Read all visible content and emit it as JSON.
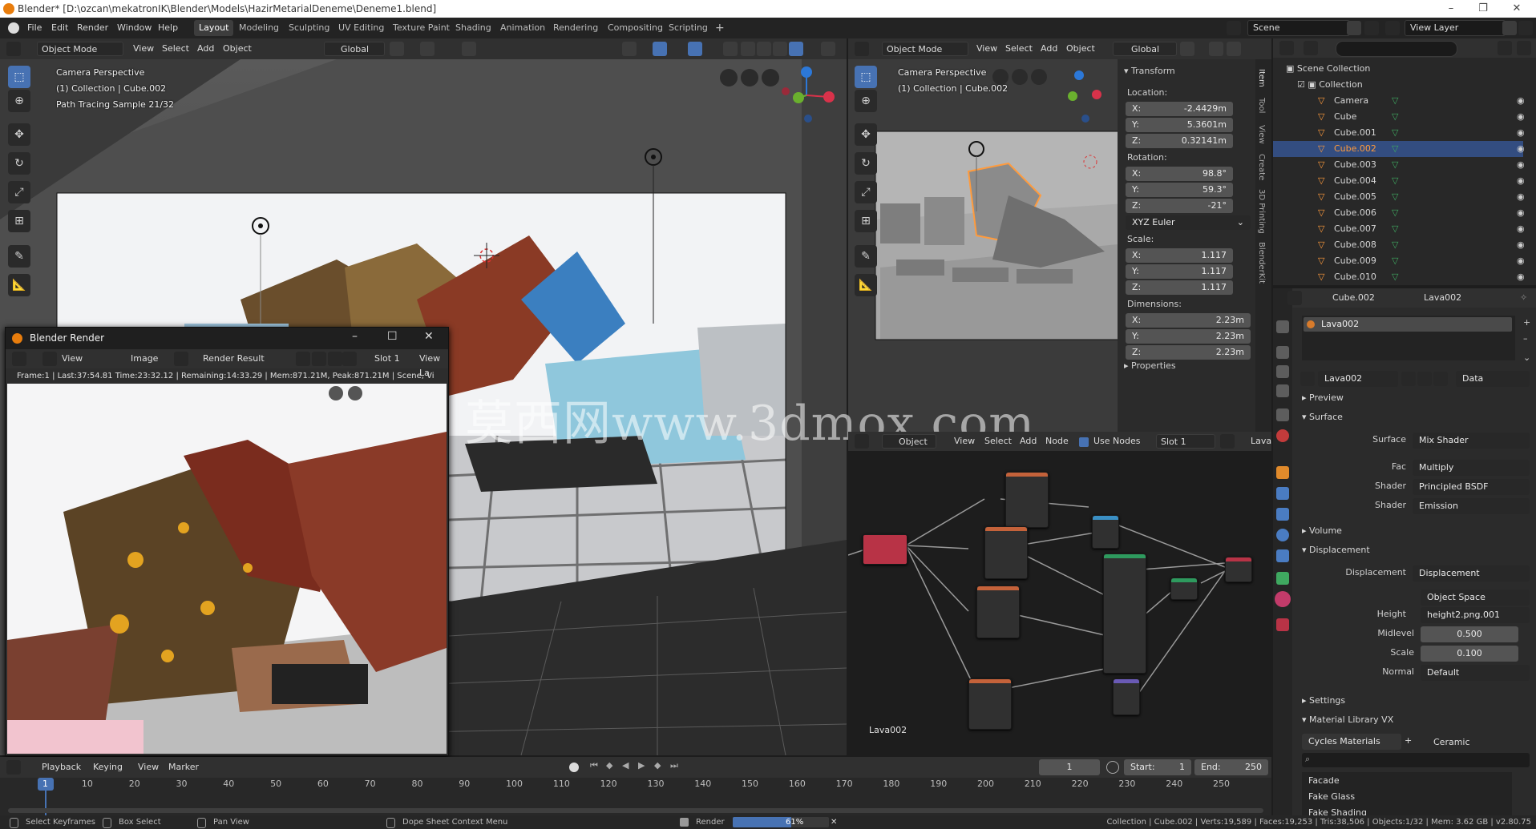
{
  "window": {
    "title": "Blender* [D:\\ozcan\\mekatronIK\\Blender\\Models\\HazirMetarialDeneme\\Deneme1.blend]",
    "controls": [
      "–",
      "❐",
      "✕"
    ]
  },
  "menu": {
    "items": [
      "File",
      "Edit",
      "Render",
      "Window",
      "Help"
    ],
    "workspaces": [
      "Layout",
      "Modeling",
      "Sculpting",
      "UV Editing",
      "Texture Paint",
      "Shading",
      "Animation",
      "Rendering",
      "Compositing",
      "Scripting"
    ],
    "active_workspace": "Layout",
    "add_workspace": "+",
    "scene": "Scene",
    "view_layer": "View Layer"
  },
  "viewport1": {
    "mode": "Object Mode",
    "menus": [
      "View",
      "Select",
      "Add",
      "Object"
    ],
    "orientation": "Global",
    "overlay": [
      "Camera Perspective",
      "(1) Collection | Cube.002",
      "Path Tracing Sample 21/32"
    ]
  },
  "viewport2": {
    "mode": "Object Mode",
    "menus": [
      "View",
      "Select",
      "Add",
      "Object"
    ],
    "orientation": "Global",
    "overlay": [
      "Camera Perspective",
      "(1) Collection | Cube.002"
    ]
  },
  "npanel": {
    "title": "Transform",
    "location_label": "Location:",
    "location": [
      {
        "axis": "X:",
        "value": "-2.4429m"
      },
      {
        "axis": "Y:",
        "value": "5.3601m"
      },
      {
        "axis": "Z:",
        "value": "0.32141m"
      }
    ],
    "rotation_label": "Rotation:",
    "rotation": [
      {
        "axis": "X:",
        "value": "98.8°"
      },
      {
        "axis": "Y:",
        "value": "59.3°"
      },
      {
        "axis": "Z:",
        "value": "-21°"
      }
    ],
    "rotation_mode": "XYZ Euler",
    "scale_label": "Scale:",
    "scale": [
      {
        "axis": "X:",
        "value": "1.117"
      },
      {
        "axis": "Y:",
        "value": "1.117"
      },
      {
        "axis": "Z:",
        "value": "1.117"
      }
    ],
    "dimensions_label": "Dimensions:",
    "dimensions": [
      {
        "axis": "X:",
        "value": "2.23m"
      },
      {
        "axis": "Y:",
        "value": "2.23m"
      },
      {
        "axis": "Z:",
        "value": "2.23m"
      }
    ],
    "properties": "Properties",
    "tabs": [
      "Item",
      "Tool",
      "View",
      "Create",
      "3D Printing",
      "BlenderKit"
    ]
  },
  "render_window": {
    "title": "Blender Render",
    "menus": [
      "View",
      "Image"
    ],
    "result": "Render Result",
    "slot": "Slot 1",
    "view_layer": "View La",
    "info": "Frame:1 | Last:37:54.81 Time:23:32.12 | Remaining:14:33.29 | Mem:871.21M, Peak:871.21M | Scene, Vi"
  },
  "watermark": "莫西网www.3dmox.com",
  "node_editor": {
    "type": "Object",
    "menus": [
      "View",
      "Select",
      "Add",
      "Node"
    ],
    "use_nodes": "Use Nodes",
    "slot": "Slot 1",
    "material": "Lava",
    "label": "Lava002"
  },
  "outliner": {
    "scene_collection": "Scene Collection",
    "collection": "Collection",
    "items": [
      "Camera",
      "Cube",
      "Cube.001",
      "Cube.002",
      "Cube.003",
      "Cube.004",
      "Cube.005",
      "Cube.006",
      "Cube.007",
      "Cube.008",
      "Cube.009",
      "Cube.010"
    ],
    "selected": "Cube.002"
  },
  "properties": {
    "object": "Cube.002",
    "material": "Lava002",
    "slot_item": "Lava002",
    "datablock": "Lava002",
    "link": "Data",
    "sections": {
      "preview": "Preview",
      "surface": "Surface",
      "volume": "Volume",
      "displacement": "Displacement",
      "settings": "Settings",
      "matlib": "Material Library VX"
    },
    "surface_rows": [
      {
        "label": "Surface",
        "value": "Mix Shader"
      },
      {
        "label": "Fac",
        "value": "Multiply"
      },
      {
        "label": "Shader",
        "value": "Principled BSDF"
      },
      {
        "label": "Shader",
        "value": "Emission"
      }
    ],
    "displacement_rows": [
      {
        "label": "Displacement",
        "value": "Displacement"
      },
      {
        "label": "",
        "value": "Object Space"
      },
      {
        "label": "Height",
        "value": "height2.png.001"
      }
    ],
    "midlevel": {
      "label": "Midlevel",
      "value": "0.500"
    },
    "scale": {
      "label": "Scale",
      "value": "0.100"
    },
    "normal": {
      "label": "Normal",
      "value": "Default"
    },
    "library": "Cycles Materials",
    "library_category": "Ceramic",
    "library_items": [
      "Facade",
      "Fake Glass",
      "Fake Shading"
    ]
  },
  "timeline": {
    "menus": [
      "Playback",
      "Keying",
      "View",
      "Marker"
    ],
    "current_frame": "1",
    "start": "Start:",
    "start_value": "1",
    "end": "End:",
    "end_value": "250",
    "ticks": [
      "1",
      "10",
      "20",
      "30",
      "40",
      "50",
      "60",
      "70",
      "80",
      "90",
      "100",
      "110",
      "120",
      "130",
      "140",
      "150",
      "160",
      "170",
      "180",
      "190",
      "200",
      "210",
      "220",
      "230",
      "240",
      "250"
    ]
  },
  "statusbar": {
    "hints": [
      "Select Keyframes",
      "Box Select",
      "Pan View",
      "Dope Sheet Context Menu"
    ],
    "render_label": "Render",
    "render_progress": 0.61,
    "render_progress_text": "61%",
    "stats": "Collection | Cube.002 | Verts:19,589 | Faces:19,253 | Tris:38,506 | Objects:1/32 | Mem: 3.62 GB | v2.80.75"
  }
}
